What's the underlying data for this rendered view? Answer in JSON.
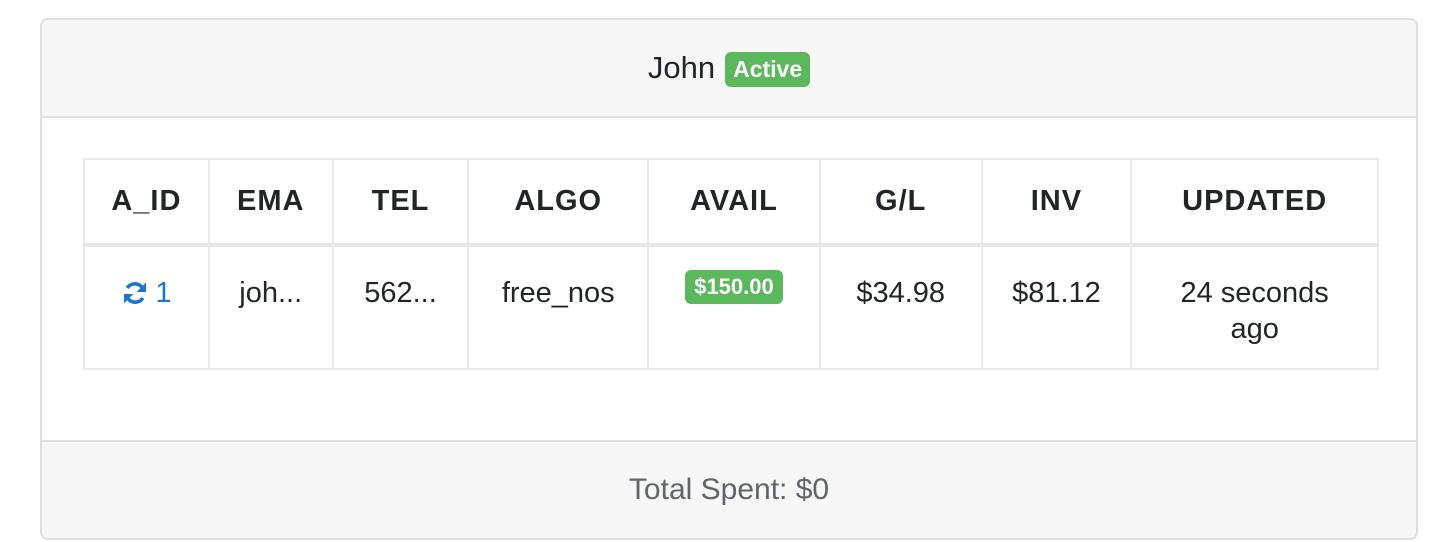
{
  "header": {
    "name": "John",
    "status_badge": "Active"
  },
  "table": {
    "columns": [
      "A_ID",
      "EMA",
      "TEL",
      "ALGO",
      "AVAIL",
      "G/L",
      "INV",
      "UPDATED"
    ],
    "rows": [
      {
        "a_id": "1",
        "ema": "joh...",
        "tel": "562...",
        "algo": "free_nos",
        "avail": "$150.00",
        "gl": "$34.98",
        "inv": "$81.12",
        "updated": "24 seconds ago"
      }
    ]
  },
  "footer": {
    "total_spent": "Total Spent: $0"
  },
  "icons": {
    "refresh": "refresh-icon"
  },
  "colors": {
    "success": "#5cb85c",
    "link": "#1b76d0"
  }
}
